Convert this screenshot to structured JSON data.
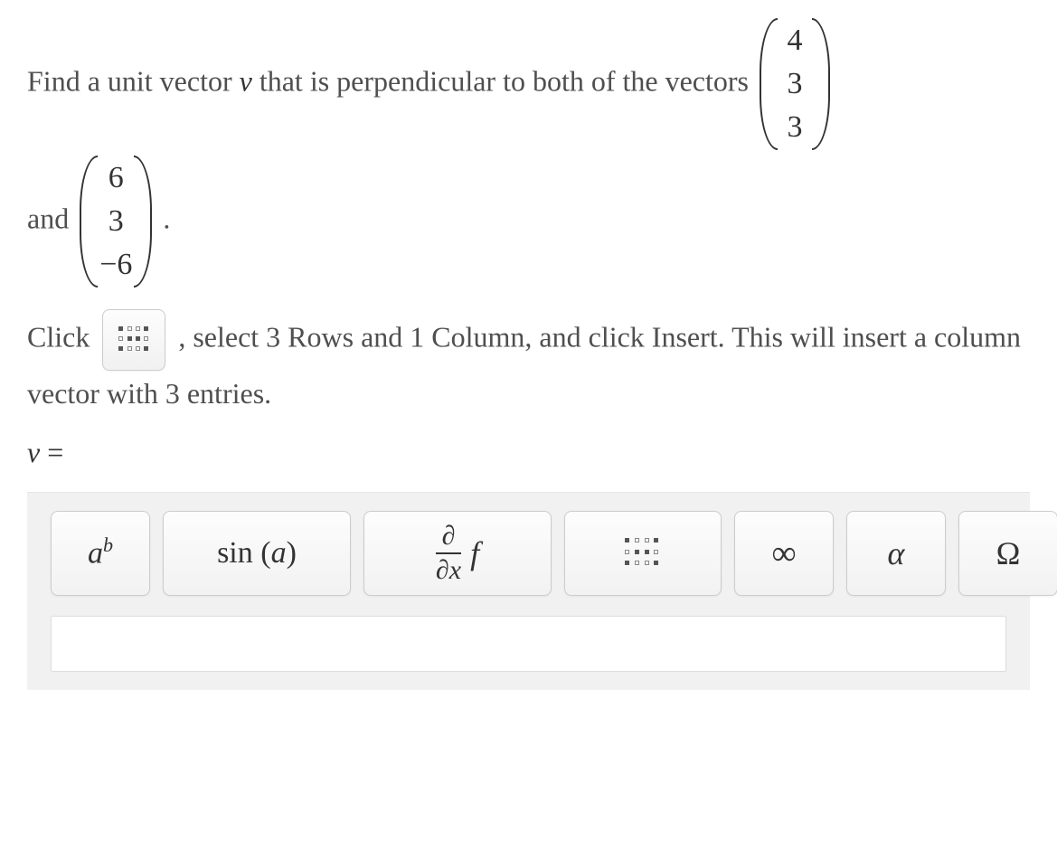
{
  "problem": {
    "part1": "Find a unit vector ",
    "var_v": "v",
    "part2": " that is perpendicular to both of the vectors ",
    "vec_a": {
      "e1": "4",
      "e2": "3",
      "e3": "3"
    },
    "and": "and ",
    "vec_b": {
      "e1": "6",
      "e2": "3",
      "e3": "−6"
    },
    "period": "."
  },
  "hint": {
    "click": "Click ",
    "after_icon": ", select 3 Rows and 1 Column, and click Insert. This will insert a column vector with 3 entries."
  },
  "answer": {
    "lhs_var": "v",
    "equals": " ="
  },
  "toolbar": {
    "superscript": {
      "base": "a",
      "exp": "b"
    },
    "trig": {
      "fn": "sin",
      "open": " (",
      "arg": "a",
      "close": ")"
    },
    "deriv": {
      "num": "∂",
      "den_d": "∂",
      "den_x": "x",
      "f": "f"
    },
    "matrix": "matrix",
    "infinity": "∞",
    "alpha": "α",
    "omega": "Ω"
  }
}
